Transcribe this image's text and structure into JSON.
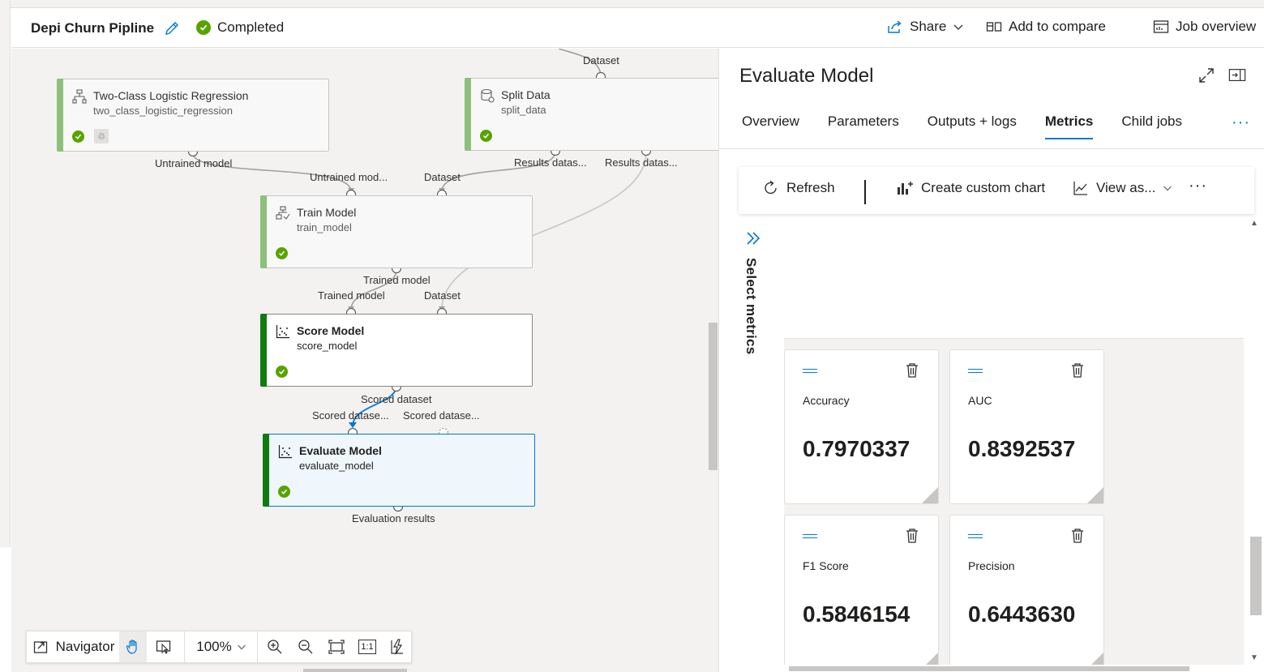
{
  "header": {
    "title": "Depi Churn Pipline",
    "status": "Completed",
    "share_label": "Share",
    "compare_label": "Add to compare",
    "overview_label": "Job overview"
  },
  "canvas": {
    "nodes": [
      {
        "title": "Two-Class Logistic Regression",
        "subtitle": "two_class_logistic_regression"
      },
      {
        "title": "Split Data",
        "subtitle": "split_data"
      },
      {
        "title": "Train Model",
        "subtitle": "train_model"
      },
      {
        "title": "Score Model",
        "subtitle": "score_model"
      },
      {
        "title": "Evaluate Model",
        "subtitle": "evaluate_model"
      }
    ],
    "port_labels": {
      "top_dataset": "Dataset",
      "lr_out": "Untrained model",
      "train_in1": "Untrained mod...",
      "train_in2": "Dataset",
      "split_out1": "Results datas...",
      "split_out2": "Results datas...",
      "train_out": "Trained model",
      "score_in1": "Trained model",
      "score_in2": "Dataset",
      "score_out": "Scored dataset",
      "eval_in1": "Scored datase...",
      "eval_in2": "Scored datase...",
      "eval_out": "Evaluation results"
    }
  },
  "navigator": {
    "label": "Navigator",
    "zoom": "100%",
    "one_to_one": "1:1"
  },
  "panel": {
    "title": "Evaluate Model",
    "tabs": [
      "Overview",
      "Parameters",
      "Outputs + logs",
      "Metrics",
      "Child jobs"
    ],
    "active_tab": "Metrics",
    "more": "···",
    "toolbar": {
      "refresh": "Refresh",
      "custom_chart": "Create custom chart",
      "view_as": "View as...",
      "more": "···"
    },
    "select_metrics": "Select metrics",
    "metrics": [
      {
        "name": "Accuracy",
        "value": "0.7970337"
      },
      {
        "name": "AUC",
        "value": "0.8392537"
      },
      {
        "name": "F1 Score",
        "value": "0.5846154"
      },
      {
        "name": "Precision",
        "value": "0.6443630"
      }
    ]
  },
  "colors": {
    "accent": "#0078d4",
    "success": "#57a300",
    "node_bar": "#107c10"
  }
}
